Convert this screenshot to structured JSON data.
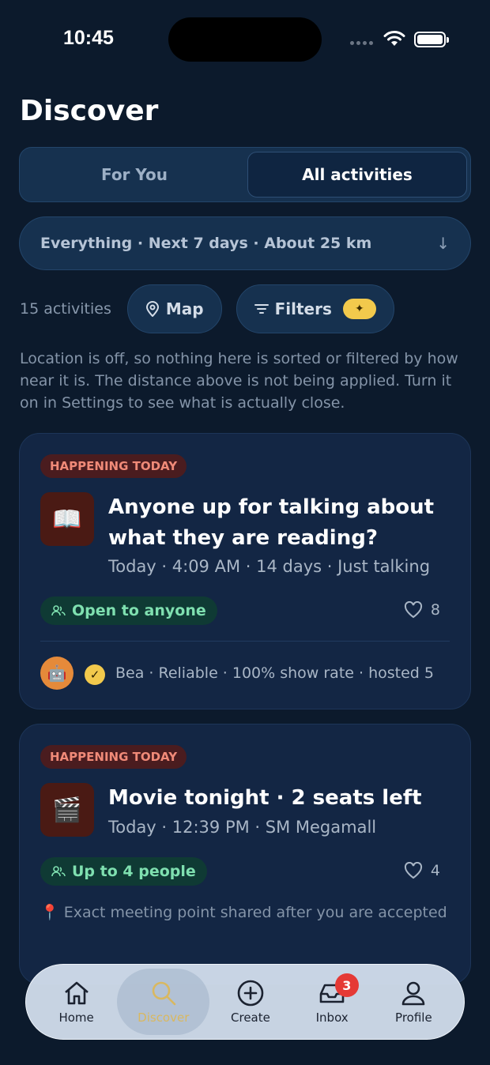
{
  "status": {
    "time": "10:45"
  },
  "page": {
    "title": "Discover"
  },
  "segments": {
    "for_you": "For You",
    "all": "All activities"
  },
  "scope": {
    "label": "Everything · Next 7 days · About 25 km",
    "arrow": "↓"
  },
  "toolbar": {
    "count": "15 activities",
    "map": "Map",
    "filters": "Filters",
    "filters_badge": "✦"
  },
  "location_note": "Location is off, so nothing here is sorted or filtered by how near it is. The distance above is not being applied. Turn it on in Settings to see what is actually close.",
  "cards": [
    {
      "tag": "HAPPENING TODAY",
      "emoji": "📖",
      "title": "Anyone up for talking about what they are reading?",
      "meta": "Today · 4:09 AM · 14 days · Just talking",
      "audience": "Open to anyone",
      "likes": "8",
      "host_avatar": "🤖",
      "host": "Bea · Reliable · 100% show rate · hosted 5"
    },
    {
      "tag": "HAPPENING TODAY",
      "emoji": "🎬",
      "title": "Movie tonight · 2 seats left",
      "meta": "Today · 12:39 PM · SM Megamall",
      "audience": "Up to 4 people",
      "likes": "4",
      "meeting_note": "📍 Exact meeting point shared after you are accepted"
    }
  ],
  "tabs": {
    "home": "Home",
    "discover": "Discover",
    "create": "Create",
    "inbox": "Inbox",
    "inbox_badge": "3",
    "profile": "Profile"
  },
  "colors": {
    "background": "#0c1a2c",
    "accent": "#f2c94c",
    "open_green": "#7fe0b0",
    "tag_red": "#f08a78"
  }
}
